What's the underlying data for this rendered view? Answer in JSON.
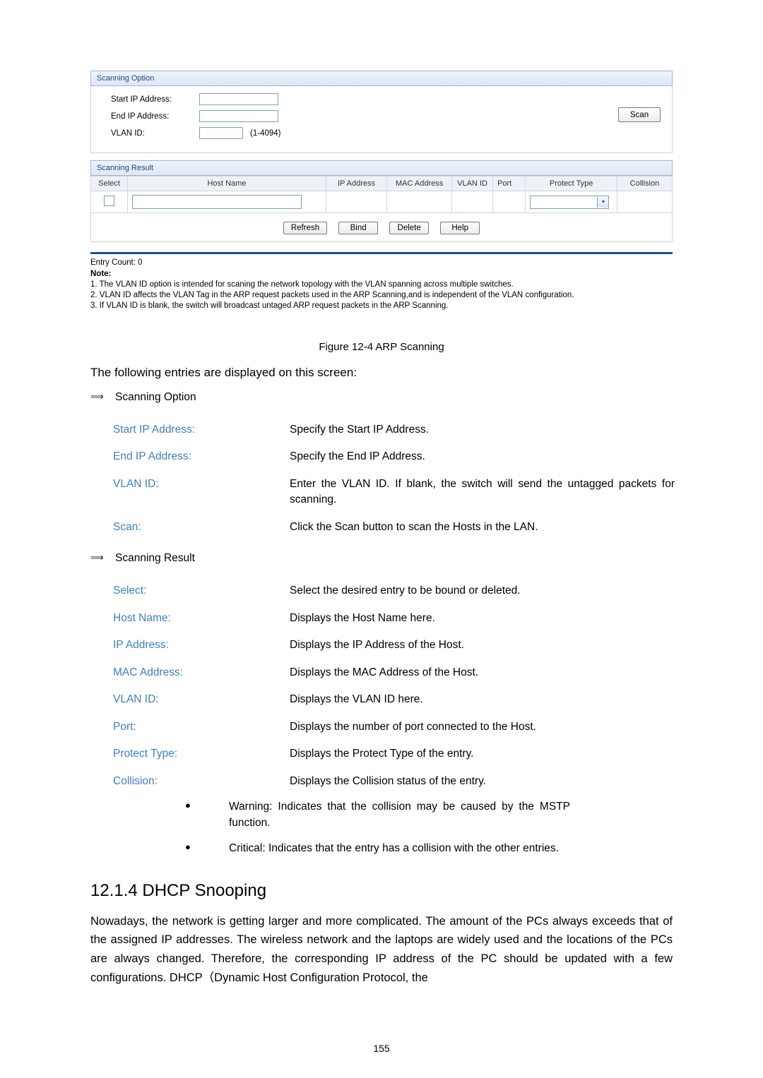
{
  "ui": {
    "scanning_option": {
      "panel_title": "Scanning Option",
      "start_ip_label": "Start IP Address:",
      "start_ip_value": "",
      "end_ip_label": "End IP Address:",
      "end_ip_value": "",
      "vlan_label": "VLAN ID:",
      "vlan_value": "",
      "vlan_hint": "(1-4094)",
      "scan_button": "Scan"
    },
    "scanning_result": {
      "panel_title": "Scanning Result",
      "columns": [
        "Select",
        "Host Name",
        "IP Address",
        "MAC Address",
        "VLAN ID",
        "Port",
        "Protect Type",
        "Collision"
      ],
      "row": {
        "host_name_value": "",
        "protect_type_value": ""
      }
    },
    "buttons": [
      "Refresh",
      "Bind",
      "Delete",
      "Help"
    ],
    "entry_count": "Entry Count: 0",
    "note_title": "Note:",
    "notes": [
      "1. The VLAN ID option is intended for scaning the network topology with the VLAN spanning across multiple switches.",
      "2. VLAN ID affects the VLAN Tag in the ARP request packets used in the ARP Scanning,and is independent of the VLAN configuration.",
      "3. If VLAN ID is blank, the switch will broadcast untaged ARP request packets in the ARP Scanning."
    ]
  },
  "doc": {
    "figure_caption": "Figure 12-4 ARP Scanning",
    "lead": "The following entries are displayed on this screen:",
    "group1": {
      "label": "Scanning Option",
      "items": [
        {
          "term": "Start IP Address:",
          "desc": "Specify the Start IP Address."
        },
        {
          "term": "End IP Address:",
          "desc": "Specify the End IP Address."
        },
        {
          "term": "VLAN ID:",
          "desc": "Enter the VLAN ID. If blank, the switch will send the untagged packets for scanning."
        },
        {
          "term": "Scan:",
          "desc": "Click the Scan button to scan the Hosts in the LAN."
        }
      ]
    },
    "group2": {
      "label": "Scanning Result",
      "items": [
        {
          "term": "Select:",
          "desc": "Select the desired entry to be bound or deleted."
        },
        {
          "term": "Host Name:",
          "desc": "Displays the Host Name here."
        },
        {
          "term": "IP Address:",
          "desc": "Displays the IP Address of the Host."
        },
        {
          "term": "MAC Address:",
          "desc": "Displays the MAC Address of the Host."
        },
        {
          "term": "VLAN ID:",
          "desc": "Displays the VLAN ID here."
        },
        {
          "term": "Port:",
          "desc": "Displays the number of port connected to the Host."
        },
        {
          "term": "Protect Type:",
          "desc": "Displays the Protect Type of the entry."
        },
        {
          "term": "Collision:",
          "desc": "Displays the Collision status of the entry."
        }
      ],
      "sub_items": [
        "Warning: Indicates that the collision may be caused by the MSTP function.",
        "Critical: Indicates that the entry has a collision with the other entries."
      ]
    },
    "section_heading": "12.1.4  DHCP Snooping",
    "paragraph": "Nowadays, the network is getting larger and more complicated. The amount of the PCs always exceeds that of the assigned IP addresses. The wireless network and the laptops are widely used and the locations of the PCs are always changed. Therefore, the corresponding IP address of the PC should be updated with a few configurations. DHCP（Dynamic Host Configuration Protocol, the",
    "page_number": "155"
  }
}
